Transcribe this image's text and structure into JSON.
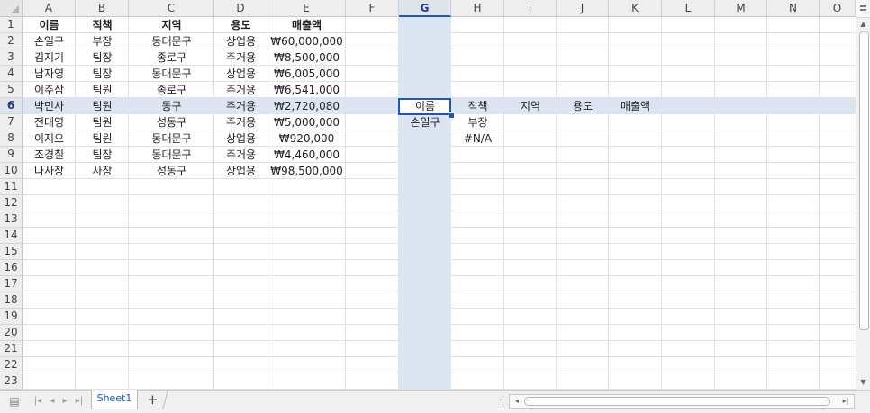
{
  "columns": [
    "A",
    "B",
    "C",
    "D",
    "E",
    "F",
    "G",
    "H",
    "I",
    "J",
    "K",
    "L",
    "M",
    "N",
    "O"
  ],
  "selected_column": "G",
  "selected_row": 6,
  "rows": [
    "1",
    "2",
    "3",
    "4",
    "5",
    "6",
    "7",
    "8",
    "9",
    "10",
    "11",
    "12",
    "13",
    "14",
    "15",
    "16",
    "17",
    "18",
    "19",
    "20",
    "21",
    "22",
    "23"
  ],
  "table": {
    "headers": [
      "이름",
      "직책",
      "지역",
      "용도",
      "매출액"
    ],
    "records": [
      [
        "손일구",
        "부장",
        "동대문구",
        "상업용",
        "₩60,000,000"
      ],
      [
        "김지기",
        "팀장",
        "종로구",
        "주거용",
        "₩8,500,000"
      ],
      [
        "남자영",
        "팀장",
        "동대문구",
        "상업용",
        "₩6,005,000"
      ],
      [
        "이주삼",
        "팀원",
        "종로구",
        "주거용",
        "₩6,541,000"
      ],
      [
        "박민사",
        "팀원",
        "동구",
        "주거용",
        "₩2,720,080"
      ],
      [
        "전대영",
        "팀원",
        "성동구",
        "주거용",
        "₩5,000,000"
      ],
      [
        "이지오",
        "팀원",
        "동대문구",
        "상업용",
        "₩920,000"
      ],
      [
        "조경칠",
        "팀장",
        "동대문구",
        "주거용",
        "₩4,460,000"
      ],
      [
        "나사장",
        "사장",
        "성동구",
        "상업용",
        "₩98,500,000"
      ]
    ]
  },
  "lookup": {
    "headers": [
      "이름",
      "직책",
      "지역",
      "용도",
      "매출액"
    ],
    "results": [
      [
        "손일구",
        "부장"
      ],
      [
        "",
        "#N/A"
      ]
    ]
  },
  "tabs": {
    "sheet1": "Sheet1",
    "add": "+"
  },
  "colors": {
    "selection": "#1a56c4",
    "highlight": "#dde5f3"
  }
}
